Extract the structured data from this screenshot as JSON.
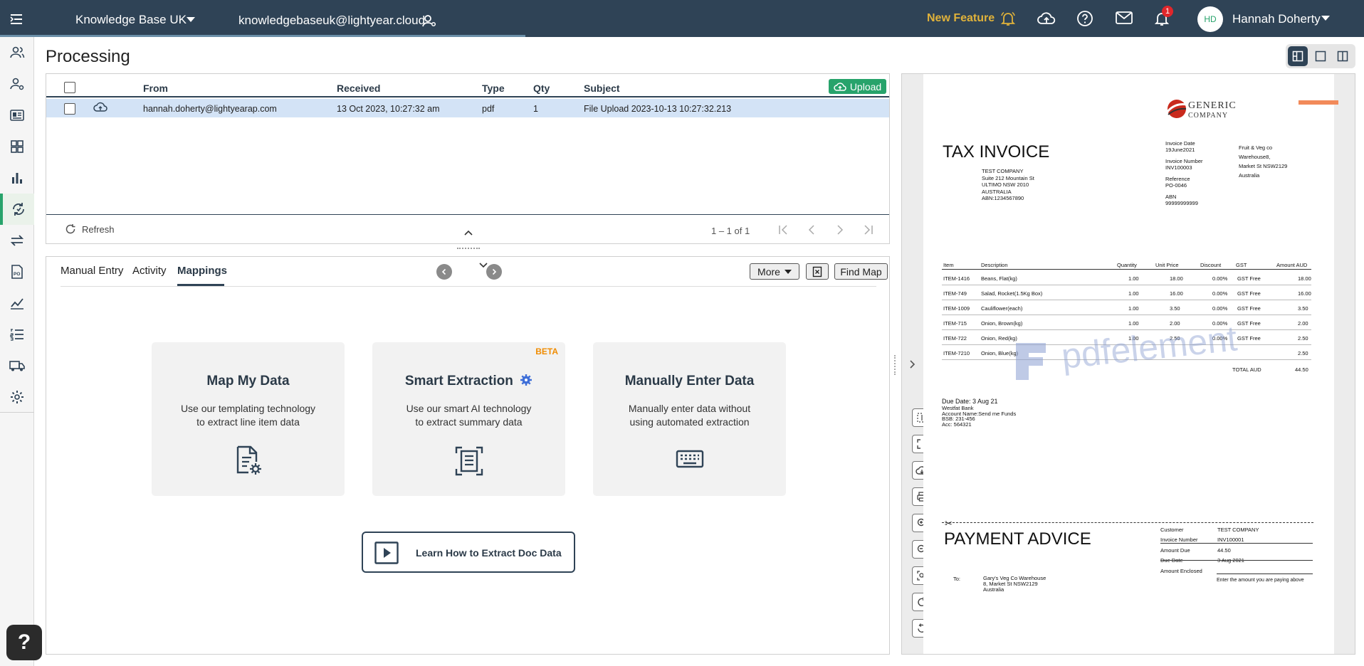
{
  "topbar": {
    "workspace": "Knowledge Base UK",
    "email": "knowledgebaseuk@lightyear.cloud",
    "new_feature": "New Feature",
    "notifications_count": "1",
    "avatar_initials": "HD",
    "user_name": "Hannah Doherty"
  },
  "page": {
    "title": "Processing"
  },
  "queue": {
    "columns": {
      "from": "From",
      "received": "Received",
      "type": "Type",
      "qty": "Qty",
      "subject": "Subject"
    },
    "upload_label": "Upload",
    "rows": [
      {
        "from": "hannah.doherty@lightyearap.com",
        "received": "13 Oct 2023, 10:27:32 am",
        "type": "pdf",
        "qty": "1",
        "subject": "File Upload 2023-10-13 10:27:32.213"
      }
    ],
    "refresh_label": "Refresh",
    "pager": "1 – 1 of 1"
  },
  "bottom": {
    "tabs": [
      "Manual Entry",
      "Activity",
      "Mappings"
    ],
    "active_tab": "Mappings",
    "more_label": "More",
    "find_map_label": "Find Map",
    "cards": [
      {
        "title": "Map My Data",
        "desc1": "Use our templating technology",
        "desc2": "to extract line item data",
        "icon": "document-gear-icon"
      },
      {
        "title": "Smart Extraction",
        "desc1": "Use our smart AI technology",
        "desc2": "to extract summary data",
        "icon": "document-scan-icon",
        "badge": "BETA"
      },
      {
        "title": "Manually Enter Data",
        "desc1": "Manually enter data without",
        "desc2": "using automated extraction",
        "icon": "keyboard-icon"
      }
    ],
    "learn_label": "Learn How to Extract Doc Data"
  },
  "invoice": {
    "logo_line1": "Generic",
    "logo_line2": "Company",
    "title": "TAX INVOICE",
    "bill_to": [
      "TEST COMPANY",
      "Suite 212 Mountain St",
      "ULTIMO NSW 2010",
      "AUSTRALIA",
      "ABN:1234567890"
    ],
    "meta": {
      "invoice_date_label": "Invoice Date",
      "invoice_date": "19June2021",
      "invoice_number_label": "Invoice Number",
      "invoice_number": "INV100003",
      "reference_label": "Reference",
      "reference": "PO-0046",
      "abn_label": "ABN",
      "abn": "99999999999"
    },
    "supplier": [
      "Fruit & Veg co",
      "Warehouse8,",
      "Market St NSW2129",
      "Australia"
    ],
    "item_headers": {
      "item": "Item",
      "description": "Description",
      "quantity": "Quantity",
      "unit_price": "Unit Price",
      "discount": "Discount",
      "gst": "GST",
      "amount": "Amount AUD"
    },
    "items": [
      {
        "item": "ITEM-1416",
        "description": "Beans, Flat(kg)",
        "quantity": "1.00",
        "unit_price": "18.00",
        "discount": "0.00%",
        "gst": "GST Free",
        "amount": "18.00"
      },
      {
        "item": "ITEM-749",
        "description": "Salad, Rocket(1.5Kg Box)",
        "quantity": "1.00",
        "unit_price": "16.00",
        "discount": "0.00%",
        "gst": "GST Free",
        "amount": "16.00"
      },
      {
        "item": "ITEM-1009",
        "description": "Cauliflower(each)",
        "quantity": "1.00",
        "unit_price": "3.50",
        "discount": "0.00%",
        "gst": "GST Free",
        "amount": "3.50"
      },
      {
        "item": "ITEM-715",
        "description": "Onion, Brown(kg)",
        "quantity": "1.00",
        "unit_price": "2.00",
        "discount": "0.00%",
        "gst": "GST Free",
        "amount": "2.00"
      },
      {
        "item": "ITEM-722",
        "description": "Onion, Red(kg)",
        "quantity": "1.00",
        "unit_price": "2.50",
        "discount": "0.00%",
        "gst": "GST Free",
        "amount": "2.50"
      },
      {
        "item": "ITEM-7210",
        "description": "Onion, Blue(kg)",
        "quantity": "",
        "unit_price": "",
        "discount": "",
        "gst": "",
        "amount": "2.50"
      }
    ],
    "total_label": "TOTAL AUD",
    "total": "44.50",
    "watermark": "pdfelement",
    "due": [
      "Due Date: 3 Aug 21",
      "Westfat Bank",
      "Account Name:Send me Funds",
      "BSB: 231-456",
      "Acc: 564321"
    ],
    "payment_title": "PAYMENT ADVICE",
    "to_label": "To:",
    "to_lines": [
      "Gary's Veg Co Warehouse",
      "8, Market St NSW2129",
      "Australia"
    ],
    "advice": {
      "customer_label": "Customer",
      "customer": "TEST COMPANY",
      "invoice_number_label": "Invoice Number",
      "invoice_number": "INV100001",
      "amount_due_label": "Amount Due",
      "amount_due": "44.50",
      "due_date_label": "Due Date",
      "due_date": "3 Aug 2021",
      "amount_enclosed_label": "Amount Enclosed",
      "enclosed_note": "Enter the amount you are paying above"
    }
  },
  "colors": {
    "topbar": "#2f4356",
    "accent_green": "#27a36b",
    "new_feature": "#e0b23a",
    "selected_row": "#d3e3f6",
    "beta": "#f08c00"
  }
}
